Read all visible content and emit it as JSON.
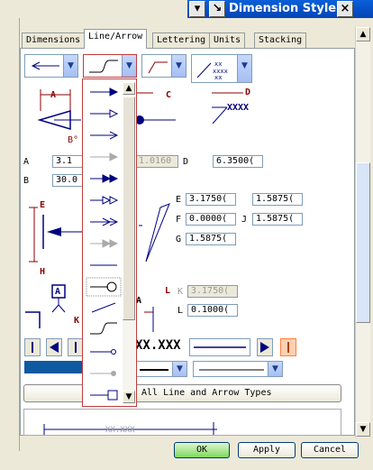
{
  "window": {
    "title": "Dimension Style",
    "close_glyph": "×"
  },
  "tabs": [
    "Dimensions",
    "Line/Arrow",
    "Lettering",
    "Units",
    "Stacking"
  ],
  "active_tab": 1,
  "labels": {
    "A": "A",
    "B": "B",
    "C": "C",
    "D": "D",
    "E": "E",
    "F": "F",
    "G": "G",
    "H": "H",
    "J": "J",
    "K": "K",
    "L": "L",
    "xxxx": "XXXX",
    "xxx": "XX.XXX",
    "b_deg": "B°"
  },
  "fields": {
    "A": "3.1",
    "A_hidden": "1.0160",
    "B": "30.0",
    "D": "6.3500(",
    "E": "3.1750(",
    "E_right": "1.5875(",
    "F": "0.0000(",
    "J": "1.5875(",
    "G": "1.5875(",
    "K": "3.1750(",
    "L": "0.1000("
  },
  "all_types_button": "All Line and Arrow Types",
  "footer_preview_text": "XX.XXX",
  "buttons": {
    "ok": "OK",
    "apply": "Apply",
    "cancel": "Cancel"
  },
  "colors": {
    "accent_blue": "#0345b5",
    "line_navy": "#000080",
    "dim_red": "#8b0000",
    "highlight_orange": "#ff8040"
  }
}
